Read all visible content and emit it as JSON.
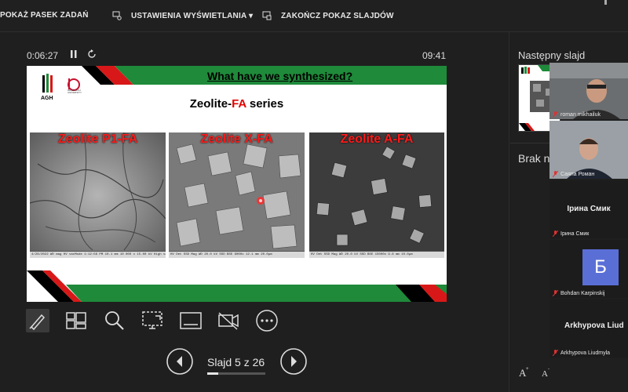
{
  "toolbar": {
    "show_taskbar": "POKAŻ PASEK ZADAŃ",
    "display_settings": "USTAWIENIA WYŚWIETLANIA ▾",
    "end_show": "ZAKOŃCZ POKAZ SLAJDÓW"
  },
  "presenter": {
    "elapsed": "0:06:27",
    "clock": "09:41",
    "slide_counter": "Slajd 5 z 26",
    "current_slide": 5,
    "total_slides": 26,
    "next_slide_label": "Następny slajd",
    "notes_label": "Brak n"
  },
  "slide": {
    "logo_text": "AGH",
    "logo_caption": "RESEARCH UNIVERSITY",
    "title": "What have we synthesized?",
    "subtitle_prefix": "Zeolite-",
    "subtitle_highlight": "FA",
    "subtitle_suffix": " series",
    "images": [
      {
        "label": "Zeolite P1-FA",
        "footer": "4/28/2022 WD mag HV vacMode 1:12:56 PM 10.1 mm 10 000 x 15.00 kV High vacuum 5 μm"
      },
      {
        "label": "Zeolite X-FA",
        "footer": "HV Det SSD Mag WD 20.0 kV SSD BSE 9000x 12.1 mm 20.0μm"
      },
      {
        "label": "Zeolite A-FA",
        "footer": "HV Det SSD Mag WD 20.0 kV SSD BSE 15000x 9.6 mm 10.0μm"
      }
    ]
  },
  "participants": [
    {
      "name": "roman mikhailuk",
      "video": true
    },
    {
      "name": "Саяпа Роман",
      "video": true
    },
    {
      "name": "Ірина Смик",
      "display": "Ірина Смик",
      "video": false
    },
    {
      "name": "Bohdan Karpinskij",
      "avatar": "Б",
      "video": false
    },
    {
      "name": "Arkhypova Liudmyla",
      "display": "Arkhypova Liud",
      "video": false
    }
  ],
  "colors": {
    "accent_green": "#1e8a3a",
    "accent_red": "#d81818",
    "avatar_bg": "#5a6fd6",
    "mic_muted": "#e03131"
  }
}
